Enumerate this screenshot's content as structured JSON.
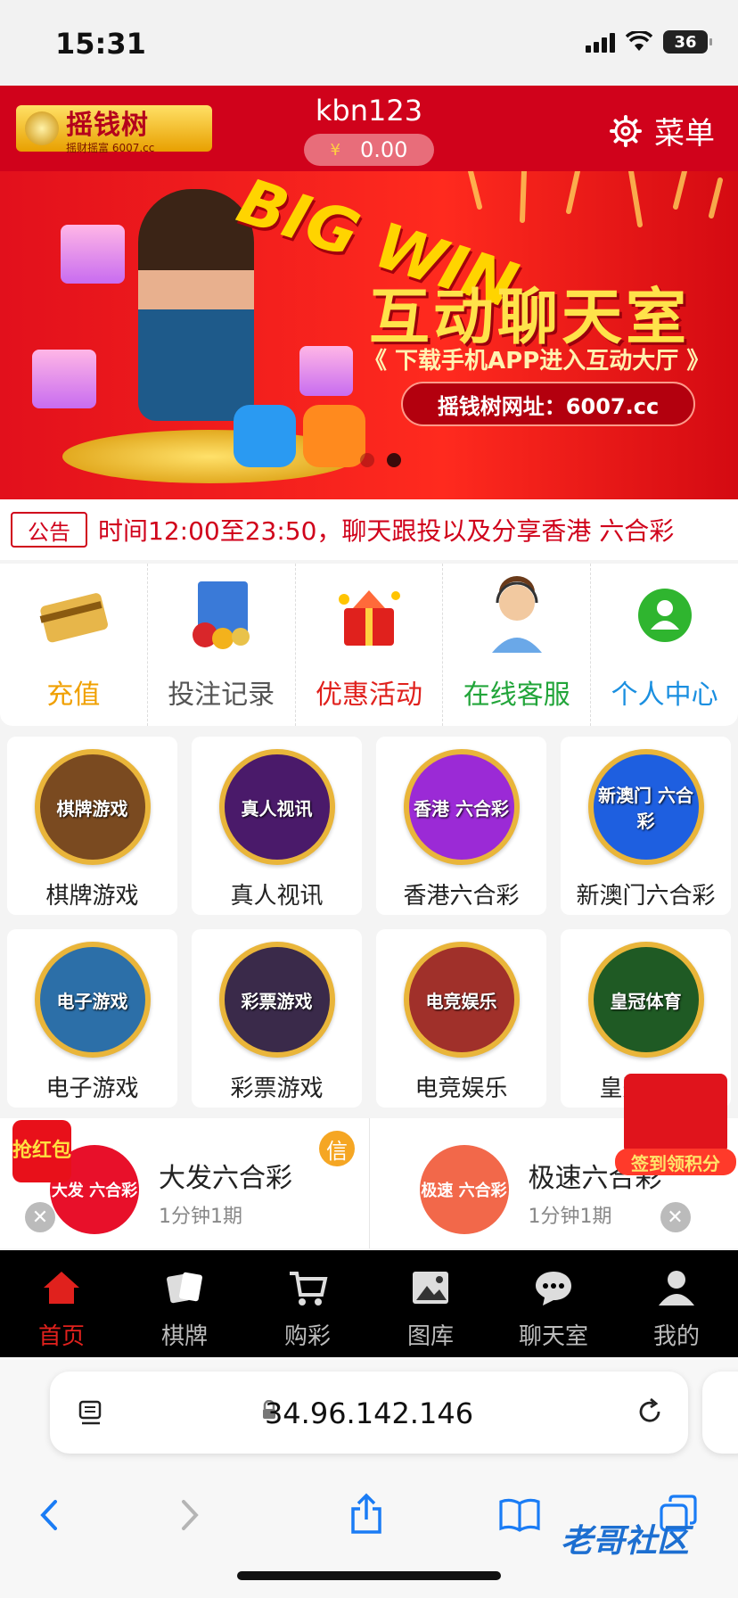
{
  "status_bar": {
    "time": "15:31",
    "battery": "36"
  },
  "header": {
    "logo_text": "摇钱树",
    "logo_sub": "摇财摇富 6007.cc",
    "username": "kbn123",
    "currency_symbol": "¥",
    "balance": "0.00",
    "menu_label": "菜单"
  },
  "banner": {
    "big_text": "BIG WIN",
    "title": "互动聊天室",
    "subtitle": "《 下载手机APP进入互动大厅 》",
    "url_text": "摇钱树网址：6007.cc"
  },
  "notice": {
    "tag": "公告",
    "text": "时间12:00至23:50，聊天跟投以及分享香港 六合彩"
  },
  "quick_links": [
    {
      "label": "充值",
      "color": "#f0a000",
      "icon": "bank-card-icon"
    },
    {
      "label": "投注记录",
      "color": "#555555",
      "icon": "lottery-ticket-icon"
    },
    {
      "label": "优惠活动",
      "color": "#e0211d",
      "icon": "gift-icon"
    },
    {
      "label": "在线客服",
      "color": "#22a53a",
      "icon": "customer-service-icon"
    },
    {
      "label": "个人中心",
      "color": "#1a8fe0",
      "icon": "user-icon"
    }
  ],
  "games": [
    {
      "label": "棋牌游戏",
      "badge": "棋牌游戏",
      "bg": "#7a4a20"
    },
    {
      "label": "真人视讯",
      "badge": "真人视讯",
      "bg": "#4a1a6a"
    },
    {
      "label": "香港六合彩",
      "badge": "香港 六合彩",
      "bg": "#9b2ad6"
    },
    {
      "label": "新澳门六合彩",
      "badge": "新澳门 六合彩",
      "bg": "#1e5fe0"
    },
    {
      "label": "电子游戏",
      "badge": "电子游戏",
      "bg": "#2c6fa8"
    },
    {
      "label": "彩票游戏",
      "badge": "彩票游戏",
      "bg": "#3a2a4a"
    },
    {
      "label": "电竞娱乐",
      "badge": "电竞娱乐",
      "bg": "#a0302a"
    },
    {
      "label": "皇冠体育",
      "badge": "皇冠体育",
      "bg": "#1f5a24"
    }
  ],
  "lotteries": [
    {
      "name": "大发六合彩",
      "period": "1分钟1期",
      "badge": "大发 六合彩",
      "bg": "#e8102a"
    },
    {
      "name": "极速六合彩",
      "period": "1分钟1期",
      "badge": "极速 六合彩",
      "bg": "#f2684a"
    }
  ],
  "promo": {
    "xin": "信",
    "qiang": "抢红包",
    "signin": "签到领积分"
  },
  "tabs": [
    {
      "label": "首页",
      "icon": "home-icon"
    },
    {
      "label": "棋牌",
      "icon": "cards-icon"
    },
    {
      "label": "购彩",
      "icon": "cart-icon"
    },
    {
      "label": "图库",
      "icon": "image-icon"
    },
    {
      "label": "聊天室",
      "icon": "chat-icon"
    },
    {
      "label": "我的",
      "icon": "user-icon"
    }
  ],
  "browser": {
    "url": "34.96.142.146"
  },
  "watermark": "老哥社区"
}
